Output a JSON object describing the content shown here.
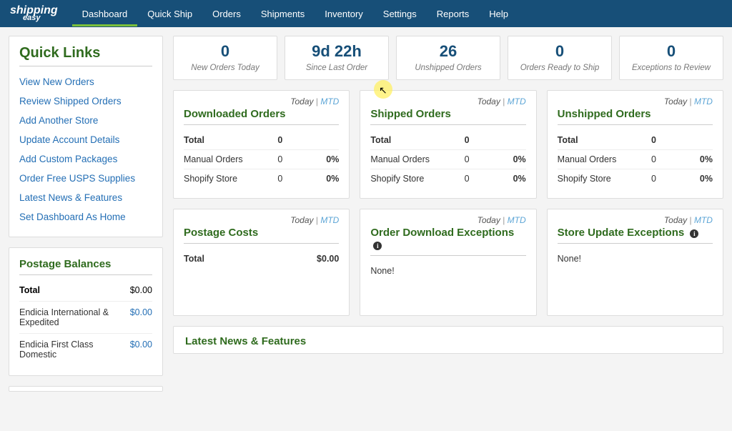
{
  "nav": {
    "items": [
      "Dashboard",
      "Quick Ship",
      "Orders",
      "Shipments",
      "Inventory",
      "Settings",
      "Reports",
      "Help"
    ],
    "active_index": 0,
    "logo_line1": "shipping",
    "logo_line2": "easy"
  },
  "quick_links": {
    "title": "Quick Links",
    "items": [
      "View New Orders",
      "Review Shipped Orders",
      "Add Another Store",
      "Update Account Details",
      "Add Custom Packages",
      "Order Free USPS Supplies",
      "Latest News & Features",
      "Set Dashboard As Home"
    ]
  },
  "postage_balances": {
    "title": "Postage Balances",
    "total_label": "Total",
    "total_value": "$0.00",
    "rows": [
      {
        "label": "Endicia International & Expedited",
        "value": "$0.00"
      },
      {
        "label": "Endicia First Class Domestic",
        "value": "$0.00"
      }
    ]
  },
  "stats": [
    {
      "value": "0",
      "label": "New Orders Today"
    },
    {
      "value": "9d 22h",
      "label": "Since Last Order"
    },
    {
      "value": "26",
      "label": "Unshipped Orders"
    },
    {
      "value": "0",
      "label": "Orders Ready to Ship"
    },
    {
      "value": "0",
      "label": "Exceptions to Review"
    }
  ],
  "period": {
    "today": "Today",
    "sep": "|",
    "mtd": "MTD"
  },
  "widgets_a": [
    {
      "title": "Downloaded Orders",
      "total_label": "Total",
      "total_value": "0",
      "rows": [
        {
          "label": "Manual Orders",
          "count": "0",
          "pct": "0%"
        },
        {
          "label": "Shopify Store",
          "count": "0",
          "pct": "0%"
        }
      ]
    },
    {
      "title": "Shipped Orders",
      "total_label": "Total",
      "total_value": "0",
      "rows": [
        {
          "label": "Manual Orders",
          "count": "0",
          "pct": "0%"
        },
        {
          "label": "Shopify Store",
          "count": "0",
          "pct": "0%"
        }
      ]
    },
    {
      "title": "Unshipped Orders",
      "total_label": "Total",
      "total_value": "0",
      "rows": [
        {
          "label": "Manual Orders",
          "count": "0",
          "pct": "0%"
        },
        {
          "label": "Shopify Store",
          "count": "0",
          "pct": "0%"
        }
      ]
    }
  ],
  "widgets_b": {
    "postage_costs": {
      "title": "Postage Costs",
      "total_label": "Total",
      "total_value": "$0.00"
    },
    "download_exceptions": {
      "title": "Order Download Exceptions",
      "none": "None!"
    },
    "update_exceptions": {
      "title": "Store Update Exceptions",
      "none": "None!"
    }
  },
  "news": {
    "title": "Latest News & Features"
  }
}
